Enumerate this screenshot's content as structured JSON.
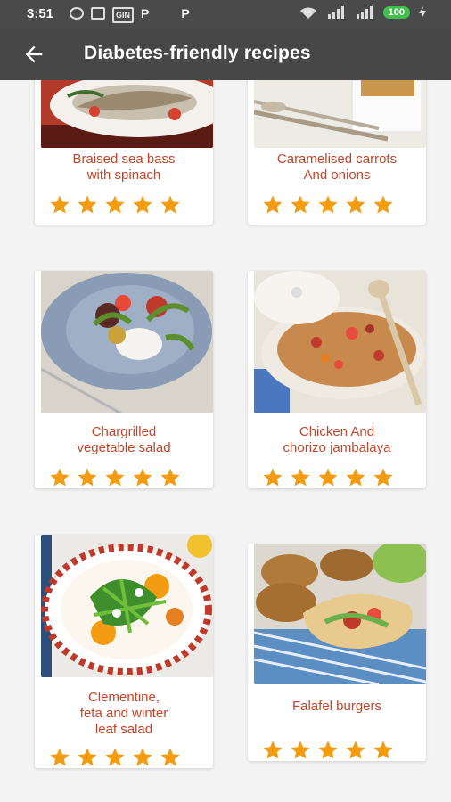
{
  "status": {
    "time": "3:51",
    "battery": "100",
    "p1": "P",
    "p2": "P",
    "grid_label": "GIN"
  },
  "appbar": {
    "title": "Diabetes-friendly recipes",
    "back_icon": "arrow-back-icon"
  },
  "colors": {
    "appbar": "#474747",
    "name": "#c2452a",
    "star": "#f39c12"
  },
  "recipes": [
    {
      "name_lines": [
        "Braised sea bass",
        "with spinach"
      ],
      "rating": 5
    },
    {
      "name_lines": [
        "Caramelised carrots",
        "And onions"
      ],
      "rating": 5
    },
    {
      "name_lines": [
        "Chargrilled",
        "vegetable salad"
      ],
      "rating": 5
    },
    {
      "name_lines": [
        "Chicken And",
        "chorizo jambalaya"
      ],
      "rating": 5
    },
    {
      "name_lines": [
        "Clementine,",
        "feta and winter",
        "leaf salad"
      ],
      "rating": 5
    },
    {
      "name_lines": [
        "Falafel burgers"
      ],
      "rating": 5
    }
  ]
}
